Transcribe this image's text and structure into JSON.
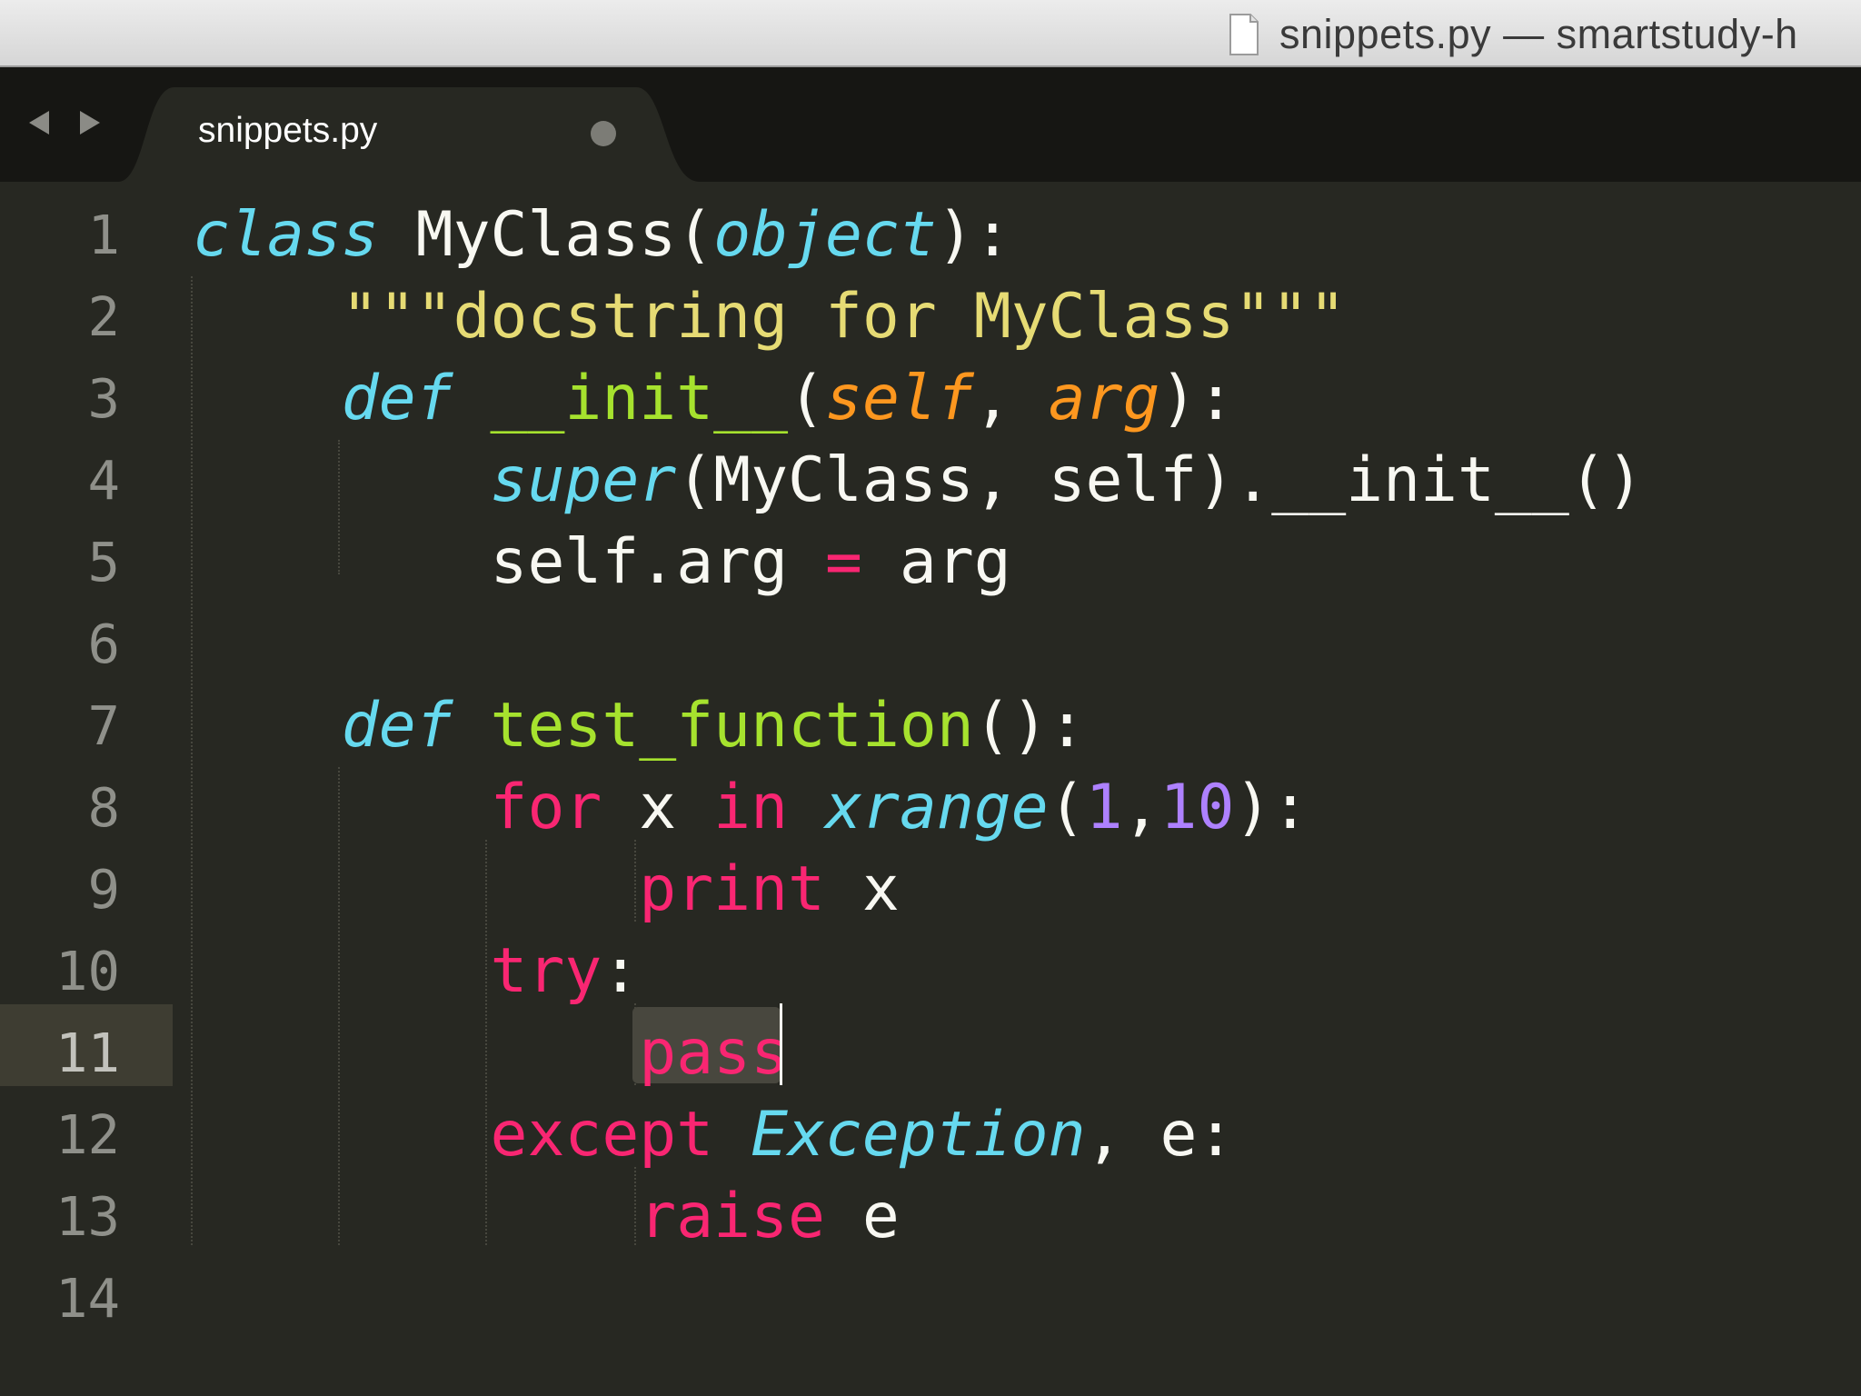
{
  "window": {
    "title": "snippets.py — smartstudy-h"
  },
  "tabs": [
    {
      "label": "snippets.py",
      "modified": true
    }
  ],
  "editor": {
    "current_line": 11,
    "lines": [
      {
        "n": "1",
        "tokens": [
          {
            "t": "class",
            "c": "st"
          },
          {
            "t": " ",
            "c": "pl"
          },
          {
            "t": "MyClass",
            "c": "pl"
          },
          {
            "t": "(",
            "c": "pl"
          },
          {
            "t": "object",
            "c": "st"
          },
          {
            "t": "):",
            "c": "pl"
          }
        ]
      },
      {
        "n": "2",
        "tokens": [
          {
            "t": "    ",
            "c": "pl"
          },
          {
            "t": "\"\"\"docstring for MyClass\"\"\"",
            "c": "str"
          }
        ]
      },
      {
        "n": "3",
        "tokens": [
          {
            "t": "    ",
            "c": "pl"
          },
          {
            "t": "def",
            "c": "st"
          },
          {
            "t": " ",
            "c": "pl"
          },
          {
            "t": "__init__",
            "c": "fn"
          },
          {
            "t": "(",
            "c": "pl"
          },
          {
            "t": "self",
            "c": "prm"
          },
          {
            "t": ", ",
            "c": "pl"
          },
          {
            "t": "arg",
            "c": "prm"
          },
          {
            "t": "):",
            "c": "pl"
          }
        ]
      },
      {
        "n": "4",
        "tokens": [
          {
            "t": "        ",
            "c": "pl"
          },
          {
            "t": "super",
            "c": "st"
          },
          {
            "t": "(MyClass, self).__init__()",
            "c": "pl"
          }
        ]
      },
      {
        "n": "5",
        "tokens": [
          {
            "t": "        ",
            "c": "pl"
          },
          {
            "t": "self.arg ",
            "c": "pl"
          },
          {
            "t": "=",
            "c": "kw"
          },
          {
            "t": " arg",
            "c": "pl"
          }
        ]
      },
      {
        "n": "6",
        "tokens": []
      },
      {
        "n": "7",
        "tokens": [
          {
            "t": "    ",
            "c": "pl"
          },
          {
            "t": "def",
            "c": "st"
          },
          {
            "t": " ",
            "c": "pl"
          },
          {
            "t": "test_function",
            "c": "fn"
          },
          {
            "t": "():",
            "c": "pl"
          }
        ]
      },
      {
        "n": "8",
        "tokens": [
          {
            "t": "        ",
            "c": "pl"
          },
          {
            "t": "for",
            "c": "kw"
          },
          {
            "t": " x ",
            "c": "pl"
          },
          {
            "t": "in",
            "c": "kw"
          },
          {
            "t": " ",
            "c": "pl"
          },
          {
            "t": "xrange",
            "c": "st"
          },
          {
            "t": "(",
            "c": "pl"
          },
          {
            "t": "1",
            "c": "num"
          },
          {
            "t": ",",
            "c": "pl"
          },
          {
            "t": "10",
            "c": "num"
          },
          {
            "t": "):",
            "c": "pl"
          }
        ]
      },
      {
        "n": "9",
        "tokens": [
          {
            "t": "            ",
            "c": "pl"
          },
          {
            "t": "print",
            "c": "kw"
          },
          {
            "t": " x",
            "c": "pl"
          }
        ]
      },
      {
        "n": "10",
        "tokens": [
          {
            "t": "        ",
            "c": "pl"
          },
          {
            "t": "try",
            "c": "kw"
          },
          {
            "t": ":",
            "c": "pl"
          }
        ]
      },
      {
        "n": "11",
        "tokens": [
          {
            "t": "            ",
            "c": "pl"
          },
          {
            "t": "pass",
            "c": "kw"
          }
        ]
      },
      {
        "n": "12",
        "tokens": [
          {
            "t": "        ",
            "c": "pl"
          },
          {
            "t": "except",
            "c": "kw"
          },
          {
            "t": " ",
            "c": "pl"
          },
          {
            "t": "Exception",
            "c": "st"
          },
          {
            "t": ", e:",
            "c": "pl"
          }
        ]
      },
      {
        "n": "13",
        "tokens": [
          {
            "t": "            ",
            "c": "pl"
          },
          {
            "t": "raise",
            "c": "kw"
          },
          {
            "t": " e",
            "c": "pl"
          }
        ]
      },
      {
        "n": "14",
        "tokens": []
      }
    ]
  },
  "theme": {
    "background": "#272822",
    "foreground": "#f8f8f2",
    "keyword": "#f92672",
    "storage": "#66d9ef",
    "function": "#a6e22e",
    "string": "#e6db74",
    "parameter": "#fd971f",
    "number": "#ae81ff",
    "gutter_text": "#8f908a",
    "line_highlight": "#3e3d32"
  }
}
